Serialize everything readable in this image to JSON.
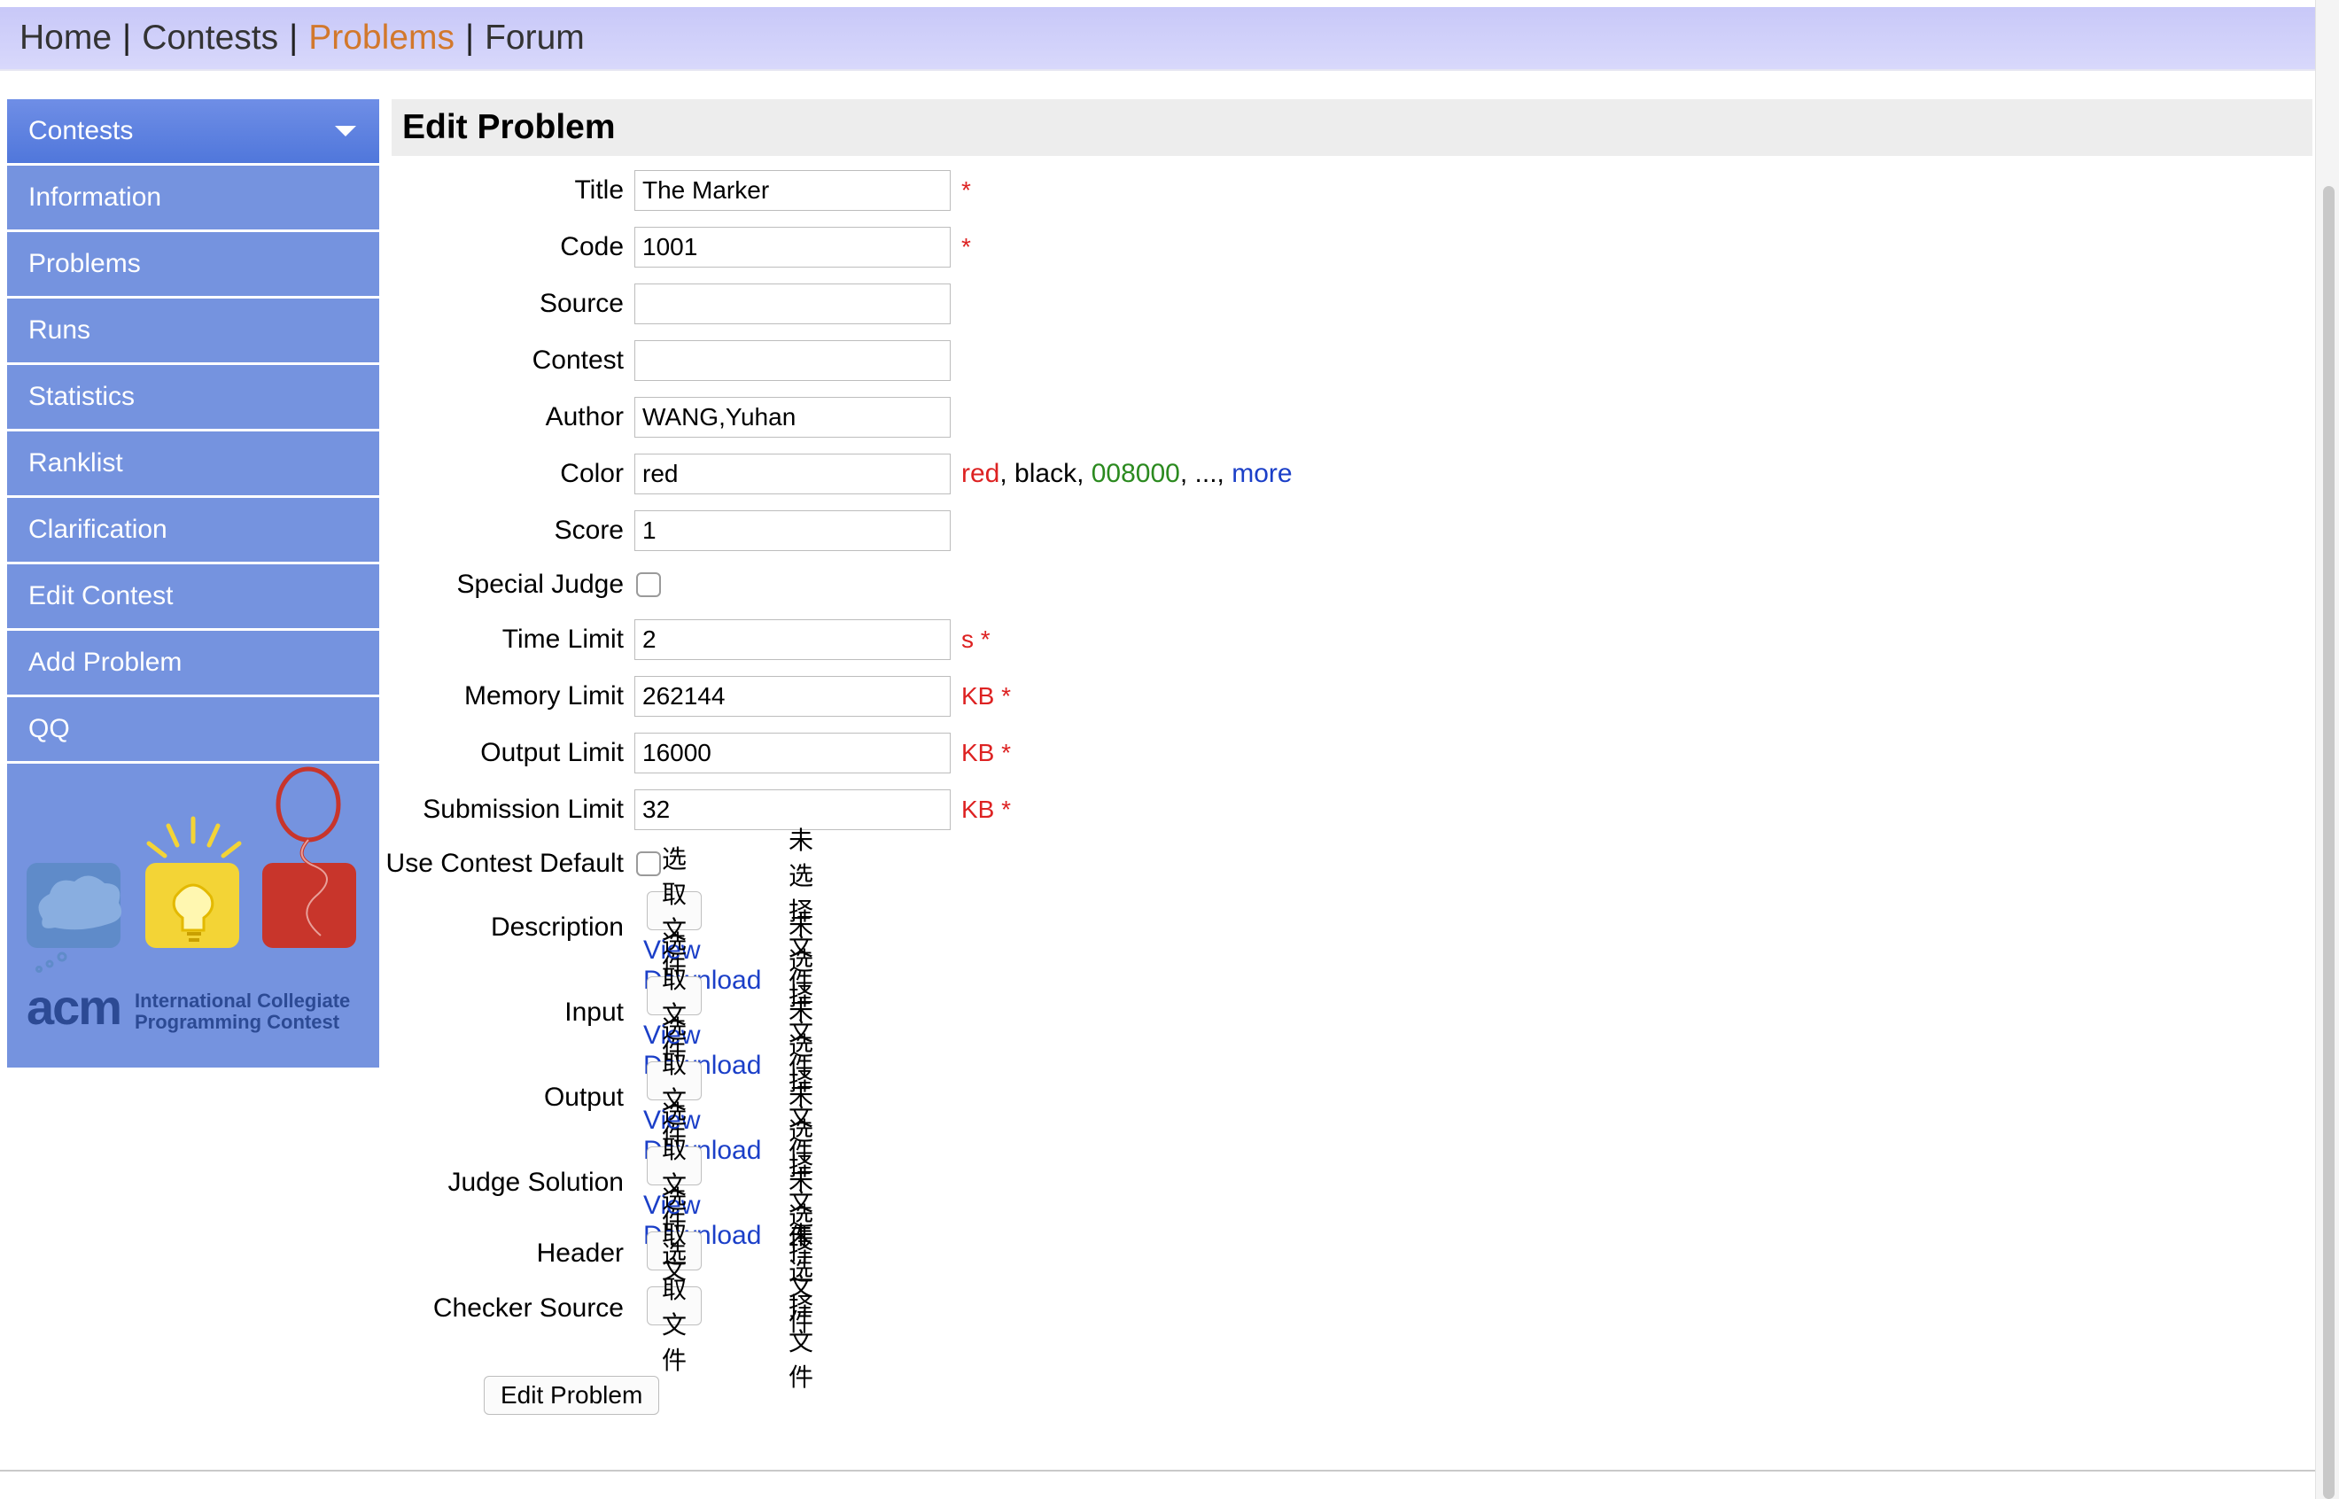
{
  "nav": {
    "items": [
      {
        "label": "Home",
        "active": false
      },
      {
        "label": "Contests",
        "active": false
      },
      {
        "label": "Problems",
        "active": true
      },
      {
        "label": "Forum",
        "active": false
      }
    ],
    "separator": "|",
    "active_color": "#d2782c"
  },
  "sidebar": {
    "header": "Contests",
    "items": [
      {
        "label": "Information"
      },
      {
        "label": "Problems"
      },
      {
        "label": "Runs"
      },
      {
        "label": "Statistics"
      },
      {
        "label": "Ranklist"
      },
      {
        "label": "Clarification"
      },
      {
        "label": "Edit Contest"
      },
      {
        "label": "Add Problem"
      },
      {
        "label": "QQ"
      }
    ],
    "logo": {
      "acm": "acm",
      "line1": "International Collegiate",
      "line2": "Programming Contest"
    }
  },
  "main": {
    "title": "Edit Problem",
    "fields": {
      "title": {
        "label": "Title",
        "value": "The Marker",
        "required": "*"
      },
      "code": {
        "label": "Code",
        "value": "1001",
        "required": "*"
      },
      "source": {
        "label": "Source",
        "value": ""
      },
      "contest": {
        "label": "Contest",
        "value": ""
      },
      "author": {
        "label": "Author",
        "value": "WANG,Yuhan"
      },
      "color": {
        "label": "Color",
        "value": "red",
        "hint_red": "red",
        "hint_sep1": ", ",
        "hint_black": "black",
        "hint_sep2": ", ",
        "hint_green": "008000",
        "hint_sep3": ", ..., ",
        "hint_more": "more"
      },
      "score": {
        "label": "Score",
        "value": "1"
      },
      "special_judge": {
        "label": "Special Judge",
        "checked": false
      },
      "time_limit": {
        "label": "Time Limit",
        "value": "2",
        "unit": "s *"
      },
      "memory_limit": {
        "label": "Memory Limit",
        "value": "262144",
        "unit": "KB *"
      },
      "output_limit": {
        "label": "Output Limit",
        "value": "16000",
        "unit": "KB *"
      },
      "submission_limit": {
        "label": "Submission Limit",
        "value": "32",
        "unit": "KB *"
      },
      "use_contest_default": {
        "label": "Use Contest Default",
        "checked": false
      }
    },
    "files": {
      "choose_label": "选取文件",
      "none_label": "未选择文件",
      "view_download": "View Download",
      "description": {
        "label": "Description"
      },
      "input": {
        "label": "Input"
      },
      "output": {
        "label": "Output"
      },
      "judge_solution": {
        "label": "Judge Solution"
      },
      "header": {
        "label": "Header"
      },
      "checker_source": {
        "label": "Checker Source"
      }
    },
    "submit_label": "Edit Problem"
  }
}
